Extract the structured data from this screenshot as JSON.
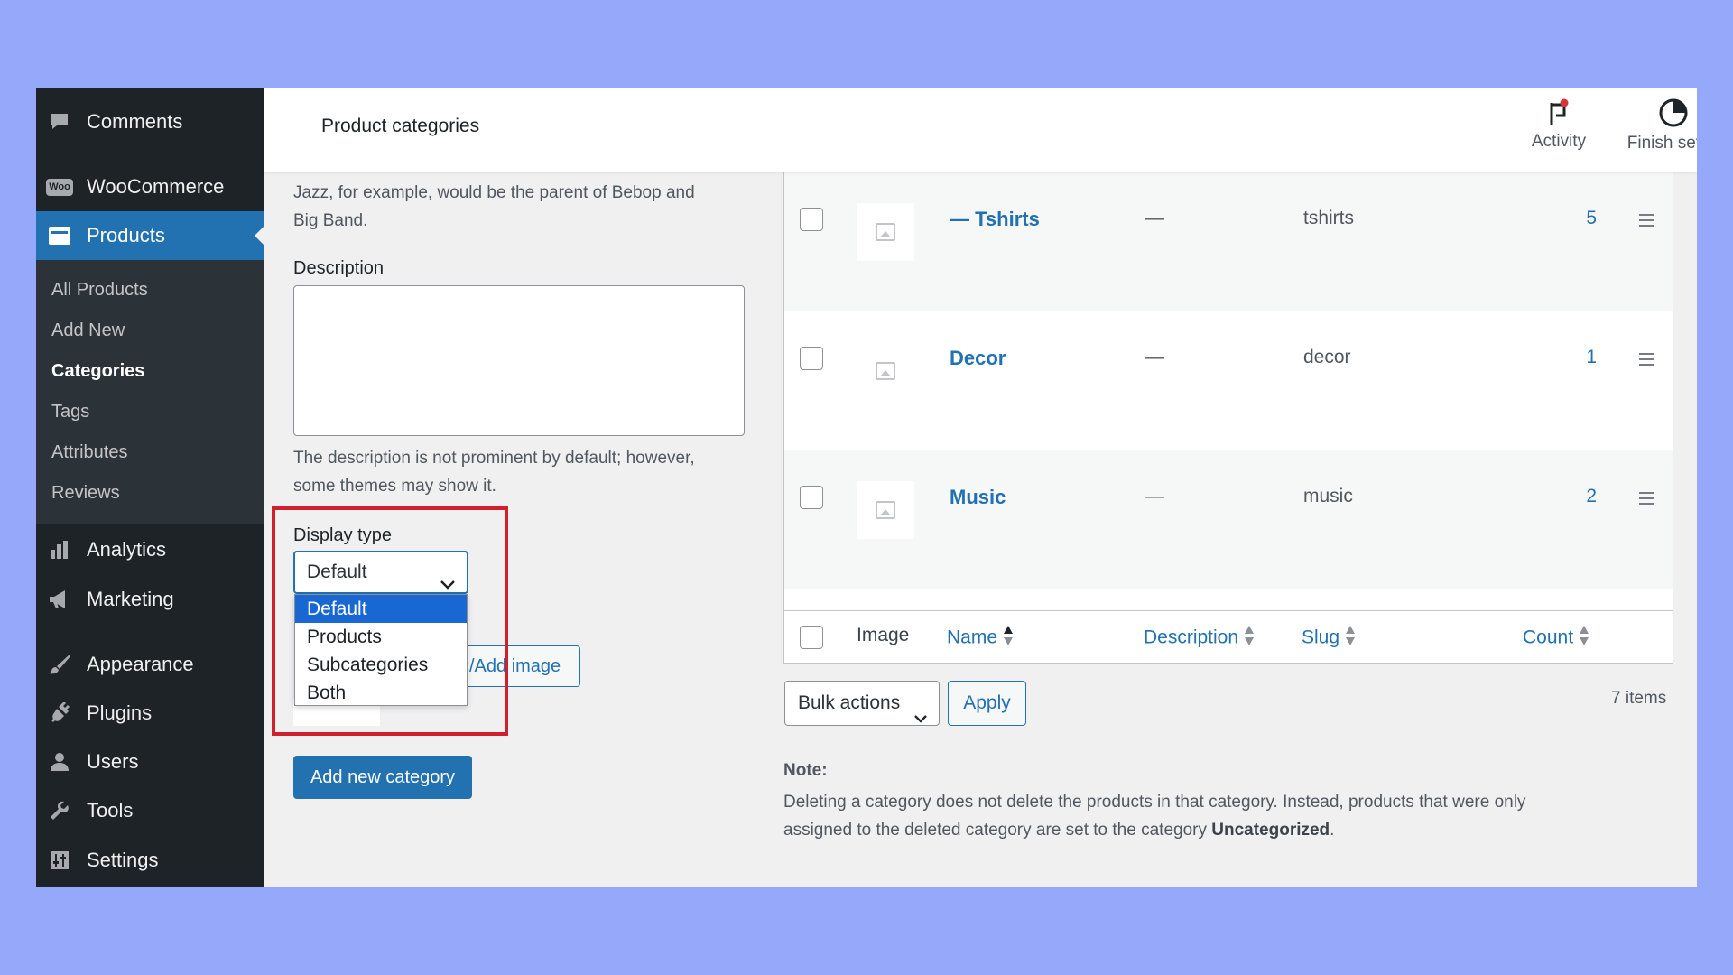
{
  "header": {
    "title": "Product categories",
    "activity_label": "Activity",
    "finish_setup_label": "Finish setup"
  },
  "sidebar": {
    "items": [
      {
        "label": "Comments",
        "icon": "comment-icon"
      },
      {
        "label": "WooCommerce",
        "icon": "woo-icon"
      },
      {
        "label": "Products",
        "icon": "products-icon"
      },
      {
        "label": "Analytics",
        "icon": "analytics-icon"
      },
      {
        "label": "Marketing",
        "icon": "megaphone-icon"
      },
      {
        "label": "Appearance",
        "icon": "brush-icon"
      },
      {
        "label": "Plugins",
        "icon": "plugin-icon"
      },
      {
        "label": "Users",
        "icon": "user-icon"
      },
      {
        "label": "Tools",
        "icon": "wrench-icon"
      },
      {
        "label": "Settings",
        "icon": "settings-icon"
      }
    ],
    "submenu": [
      "All Products",
      "Add New",
      "Categories",
      "Tags",
      "Attributes",
      "Reviews"
    ],
    "woo_badge": "Woo",
    "active": "Products",
    "current_sub": "Categories"
  },
  "form": {
    "parent_help_line1": "Jazz, for example, would be the parent of Bebop and",
    "parent_help_line2": "Big Band.",
    "description_label": "Description",
    "description_help_line1": "The description is not prominent by default; however,",
    "description_help_line2": "some themes may show it.",
    "display_type_label": "Display type",
    "display_type_value": "Default",
    "display_type_options": [
      "Default",
      "Products",
      "Subcategories",
      "Both"
    ],
    "upload_button_fragment": "/Add image",
    "add_button": "Add new category"
  },
  "table": {
    "rows": [
      {
        "name": "— Tshirts",
        "description": "—",
        "slug": "tshirts",
        "count": "5"
      },
      {
        "name": "Decor",
        "description": "—",
        "slug": "decor",
        "count": "1"
      },
      {
        "name": "Music",
        "description": "—",
        "slug": "music",
        "count": "2"
      }
    ],
    "columns": {
      "image": "Image",
      "name": "Name",
      "description": "Description",
      "slug": "Slug",
      "count": "Count"
    }
  },
  "bulk": {
    "label": "Bulk actions",
    "apply": "Apply",
    "items_count": "7 items"
  },
  "note": {
    "title": "Note:",
    "text_line1": "Deleting a category does not delete the products in that category. Instead, products that were only",
    "text_line2_pre": "assigned to the deleted category are set to the category ",
    "text_line2_bold": "Uncategorized",
    "text_line2_post": "."
  },
  "colors": {
    "accent": "#2271b1",
    "sidebar": "#1d2327",
    "highlight": "#d0202e",
    "background": "#96a8f9"
  }
}
